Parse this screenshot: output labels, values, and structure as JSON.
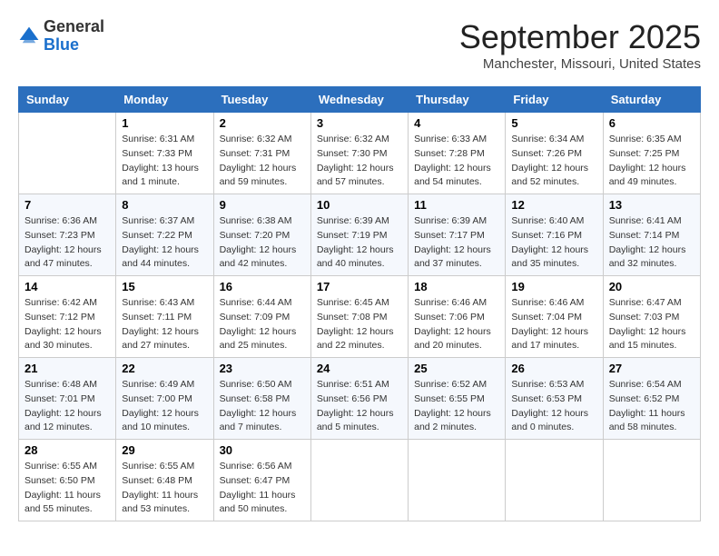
{
  "header": {
    "logo_line1": "General",
    "logo_line2": "Blue",
    "month": "September 2025",
    "location": "Manchester, Missouri, United States"
  },
  "weekdays": [
    "Sunday",
    "Monday",
    "Tuesday",
    "Wednesday",
    "Thursday",
    "Friday",
    "Saturday"
  ],
  "weeks": [
    [
      {
        "day": "",
        "info": ""
      },
      {
        "day": "1",
        "info": "Sunrise: 6:31 AM\nSunset: 7:33 PM\nDaylight: 13 hours\nand 1 minute."
      },
      {
        "day": "2",
        "info": "Sunrise: 6:32 AM\nSunset: 7:31 PM\nDaylight: 12 hours\nand 59 minutes."
      },
      {
        "day": "3",
        "info": "Sunrise: 6:32 AM\nSunset: 7:30 PM\nDaylight: 12 hours\nand 57 minutes."
      },
      {
        "day": "4",
        "info": "Sunrise: 6:33 AM\nSunset: 7:28 PM\nDaylight: 12 hours\nand 54 minutes."
      },
      {
        "day": "5",
        "info": "Sunrise: 6:34 AM\nSunset: 7:26 PM\nDaylight: 12 hours\nand 52 minutes."
      },
      {
        "day": "6",
        "info": "Sunrise: 6:35 AM\nSunset: 7:25 PM\nDaylight: 12 hours\nand 49 minutes."
      }
    ],
    [
      {
        "day": "7",
        "info": "Sunrise: 6:36 AM\nSunset: 7:23 PM\nDaylight: 12 hours\nand 47 minutes."
      },
      {
        "day": "8",
        "info": "Sunrise: 6:37 AM\nSunset: 7:22 PM\nDaylight: 12 hours\nand 44 minutes."
      },
      {
        "day": "9",
        "info": "Sunrise: 6:38 AM\nSunset: 7:20 PM\nDaylight: 12 hours\nand 42 minutes."
      },
      {
        "day": "10",
        "info": "Sunrise: 6:39 AM\nSunset: 7:19 PM\nDaylight: 12 hours\nand 40 minutes."
      },
      {
        "day": "11",
        "info": "Sunrise: 6:39 AM\nSunset: 7:17 PM\nDaylight: 12 hours\nand 37 minutes."
      },
      {
        "day": "12",
        "info": "Sunrise: 6:40 AM\nSunset: 7:16 PM\nDaylight: 12 hours\nand 35 minutes."
      },
      {
        "day": "13",
        "info": "Sunrise: 6:41 AM\nSunset: 7:14 PM\nDaylight: 12 hours\nand 32 minutes."
      }
    ],
    [
      {
        "day": "14",
        "info": "Sunrise: 6:42 AM\nSunset: 7:12 PM\nDaylight: 12 hours\nand 30 minutes."
      },
      {
        "day": "15",
        "info": "Sunrise: 6:43 AM\nSunset: 7:11 PM\nDaylight: 12 hours\nand 27 minutes."
      },
      {
        "day": "16",
        "info": "Sunrise: 6:44 AM\nSunset: 7:09 PM\nDaylight: 12 hours\nand 25 minutes."
      },
      {
        "day": "17",
        "info": "Sunrise: 6:45 AM\nSunset: 7:08 PM\nDaylight: 12 hours\nand 22 minutes."
      },
      {
        "day": "18",
        "info": "Sunrise: 6:46 AM\nSunset: 7:06 PM\nDaylight: 12 hours\nand 20 minutes."
      },
      {
        "day": "19",
        "info": "Sunrise: 6:46 AM\nSunset: 7:04 PM\nDaylight: 12 hours\nand 17 minutes."
      },
      {
        "day": "20",
        "info": "Sunrise: 6:47 AM\nSunset: 7:03 PM\nDaylight: 12 hours\nand 15 minutes."
      }
    ],
    [
      {
        "day": "21",
        "info": "Sunrise: 6:48 AM\nSunset: 7:01 PM\nDaylight: 12 hours\nand 12 minutes."
      },
      {
        "day": "22",
        "info": "Sunrise: 6:49 AM\nSunset: 7:00 PM\nDaylight: 12 hours\nand 10 minutes."
      },
      {
        "day": "23",
        "info": "Sunrise: 6:50 AM\nSunset: 6:58 PM\nDaylight: 12 hours\nand 7 minutes."
      },
      {
        "day": "24",
        "info": "Sunrise: 6:51 AM\nSunset: 6:56 PM\nDaylight: 12 hours\nand 5 minutes."
      },
      {
        "day": "25",
        "info": "Sunrise: 6:52 AM\nSunset: 6:55 PM\nDaylight: 12 hours\nand 2 minutes."
      },
      {
        "day": "26",
        "info": "Sunrise: 6:53 AM\nSunset: 6:53 PM\nDaylight: 12 hours\nand 0 minutes."
      },
      {
        "day": "27",
        "info": "Sunrise: 6:54 AM\nSunset: 6:52 PM\nDaylight: 11 hours\nand 58 minutes."
      }
    ],
    [
      {
        "day": "28",
        "info": "Sunrise: 6:55 AM\nSunset: 6:50 PM\nDaylight: 11 hours\nand 55 minutes."
      },
      {
        "day": "29",
        "info": "Sunrise: 6:55 AM\nSunset: 6:48 PM\nDaylight: 11 hours\nand 53 minutes."
      },
      {
        "day": "30",
        "info": "Sunrise: 6:56 AM\nSunset: 6:47 PM\nDaylight: 11 hours\nand 50 minutes."
      },
      {
        "day": "",
        "info": ""
      },
      {
        "day": "",
        "info": ""
      },
      {
        "day": "",
        "info": ""
      },
      {
        "day": "",
        "info": ""
      }
    ]
  ]
}
